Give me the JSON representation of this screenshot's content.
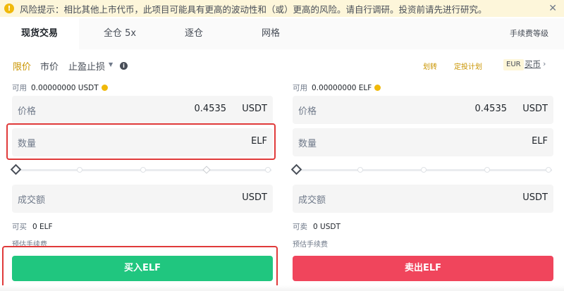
{
  "banner": {
    "text": "风险提示：相比其他上市代币，此项目可能具有更高的波动性和（或）更高的风险。请自行调研。投资前请先进行研究。",
    "close_label": "✕"
  },
  "tabs": {
    "spot": "现货交易",
    "cross": "全仓 5x",
    "isolated": "逐仓",
    "grid": "网格",
    "fee_level": "手续费等级"
  },
  "order_types": {
    "limit": "限价",
    "market": "市价",
    "stop": "止盈止损"
  },
  "links": {
    "transfer": "划转",
    "recurring": "定投计划",
    "fiat": "EUR",
    "buy_coin": "买币"
  },
  "buy": {
    "available_label": "可用",
    "available_value": "0.00000000 USDT",
    "price_label": "价格",
    "price_value": "0.4535",
    "price_unit": "USDT",
    "qty_label": "数量",
    "qty_unit": "ELF",
    "total_label": "成交额",
    "total_unit": "USDT",
    "can_label": "可买",
    "can_value": "0 ELF",
    "fee_label": "预估手续费",
    "button": "买入ELF"
  },
  "sell": {
    "available_label": "可用",
    "available_value": "0.00000000 ELF",
    "price_label": "价格",
    "price_value": "0.4535",
    "price_unit": "USDT",
    "qty_label": "数量",
    "qty_unit": "ELF",
    "total_label": "成交额",
    "total_unit": "USDT",
    "can_label": "可卖",
    "can_value": "0 USDT",
    "fee_label": "预估手续费",
    "button": "卖出ELF"
  },
  "colors": {
    "accent": "#c99400",
    "buy": "#20c67f",
    "sell": "#f0455c",
    "highlight": "#e03a3a"
  }
}
